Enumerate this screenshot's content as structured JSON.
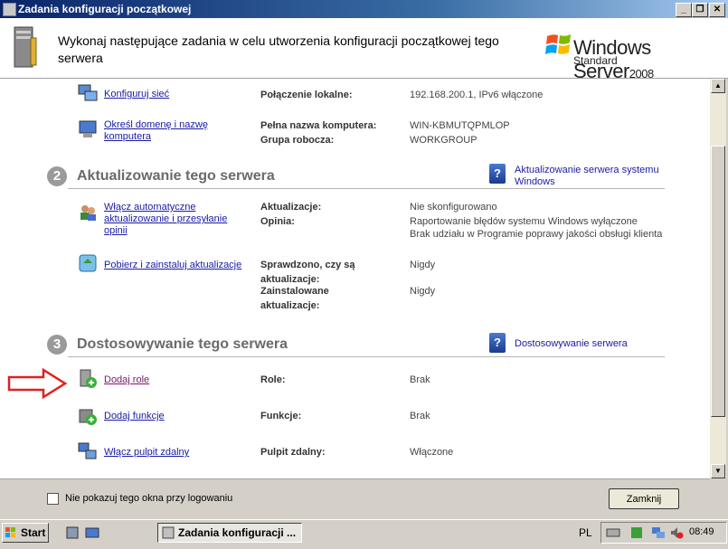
{
  "window": {
    "title": "Zadania konfiguracji początkowej",
    "buttons": {
      "minimize": "_",
      "restore": "❐",
      "close": "✕"
    }
  },
  "header": {
    "title": "Wykonaj następujące zadania w celu utworzenia konfiguracji początkowej tego serwera",
    "brand_name": "Windows Server",
    "brand_year": "2008",
    "edition": "Standard"
  },
  "tasks_top": [
    {
      "link": "Konfiguruj sieć",
      "label": "Połączenie lokalne:",
      "value": "192.168.200.1, IPv6 włączone"
    },
    {
      "link": "Określ domenę i nazwę komputera",
      "label1": "Pełna nazwa komputera:",
      "value1": "WIN-KBMUTQPMLOP",
      "label2": "Grupa robocza:",
      "value2": "WORKGROUP"
    }
  ],
  "section2": {
    "number": "2",
    "title": "Aktualizowanie tego serwera",
    "help_link": "Aktualizowanie serwera systemu Windows",
    "tasks": [
      {
        "link": "Włącz automatyczne aktualizowanie i przesyłanie opinii",
        "label1": "Aktualizacje:",
        "value1": "Nie skonfigurowano",
        "label2": "Opinia:",
        "value2a": "Raportowanie błędów systemu Windows wyłączone",
        "value2b": "Brak udziału w Programie poprawy jakości obsługi klienta"
      },
      {
        "link": "Pobierz i zainstaluj aktualizacje",
        "label1": "Sprawdzono, czy są aktualizacje:",
        "value1": "Nigdy",
        "label2": "Zainstalowane aktualizacje:",
        "value2": "Nigdy"
      }
    ]
  },
  "section3": {
    "number": "3",
    "title": "Dostosowywanie tego serwera",
    "help_link": "Dostosowywanie serwera",
    "tasks": [
      {
        "link": "Dodaj role",
        "label": "Role:",
        "value": "Brak"
      },
      {
        "link": "Dodaj funkcje",
        "label": "Funkcje:",
        "value": "Brak"
      },
      {
        "link": "Włącz pulpit zdalny",
        "label": "Pulpit zdalny:",
        "value": "Włączone"
      }
    ]
  },
  "footer": {
    "checkbox_label": "Nie pokazuj tego okna przy logowaniu",
    "close_button": "Zamknij"
  },
  "taskbar": {
    "start": "Start",
    "task_label": "Zadania konfiguracji ...",
    "language": "PL",
    "clock": "08:49"
  },
  "colors": {
    "link": "#1a1aa6",
    "arrow": "#e02020",
    "titlebar": "#0a246a"
  }
}
